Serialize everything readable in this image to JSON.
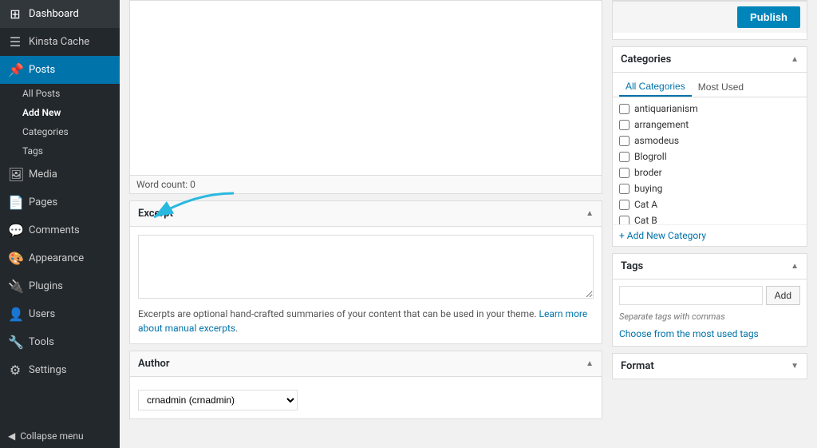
{
  "sidebar": {
    "items": [
      {
        "id": "dashboard",
        "label": "Dashboard",
        "icon": "⊞"
      },
      {
        "id": "kinsta-cache",
        "label": "Kinsta Cache",
        "icon": "☰"
      },
      {
        "id": "posts",
        "label": "Posts",
        "icon": "📌",
        "active": true
      },
      {
        "id": "media",
        "label": "Media",
        "icon": "🖼"
      },
      {
        "id": "pages",
        "label": "Pages",
        "icon": "📄"
      },
      {
        "id": "comments",
        "label": "Comments",
        "icon": "💬"
      },
      {
        "id": "appearance",
        "label": "Appearance",
        "icon": "🎨"
      },
      {
        "id": "plugins",
        "label": "Plugins",
        "icon": "🔌"
      },
      {
        "id": "users",
        "label": "Users",
        "icon": "👤"
      },
      {
        "id": "tools",
        "label": "Tools",
        "icon": "🔧"
      },
      {
        "id": "settings",
        "label": "Settings",
        "icon": "⚙"
      }
    ],
    "posts_submenu": [
      {
        "label": "All Posts",
        "active": false
      },
      {
        "label": "Add New",
        "active": true
      },
      {
        "label": "Categories",
        "active": false
      },
      {
        "label": "Tags",
        "active": false
      }
    ],
    "collapse_label": "Collapse menu"
  },
  "editor": {
    "word_count_label": "Word count: 0",
    "excerpt": {
      "title": "Excerpt",
      "textarea_placeholder": "",
      "description": "Excerpts are optional hand-crafted summaries of your content that can be used in your theme.",
      "learn_more_text": "Learn more about manual excerpts",
      "learn_more_url": "#"
    },
    "author": {
      "title": "Author",
      "selected_option": "crnadmin (crnadmin)"
    }
  },
  "right_panel": {
    "publish_button_label": "Publish",
    "categories": {
      "title": "Categories",
      "tab_all": "All Categories",
      "tab_most_used": "Most Used",
      "active_tab": "all",
      "items": [
        {
          "label": "antiquarianism",
          "checked": false
        },
        {
          "label": "arrangement",
          "checked": false
        },
        {
          "label": "asmodeus",
          "checked": false
        },
        {
          "label": "Blogroll",
          "checked": false
        },
        {
          "label": "broder",
          "checked": false
        },
        {
          "label": "buying",
          "checked": false
        },
        {
          "label": "Cat A",
          "checked": false
        },
        {
          "label": "Cat B",
          "checked": false
        }
      ],
      "add_new_label": "+ Add New Category"
    },
    "tags": {
      "title": "Tags",
      "input_placeholder": "",
      "add_button_label": "Add",
      "hint": "Separate tags with commas",
      "choose_link": "Choose from the most used tags"
    },
    "format": {
      "title": "Format"
    }
  }
}
